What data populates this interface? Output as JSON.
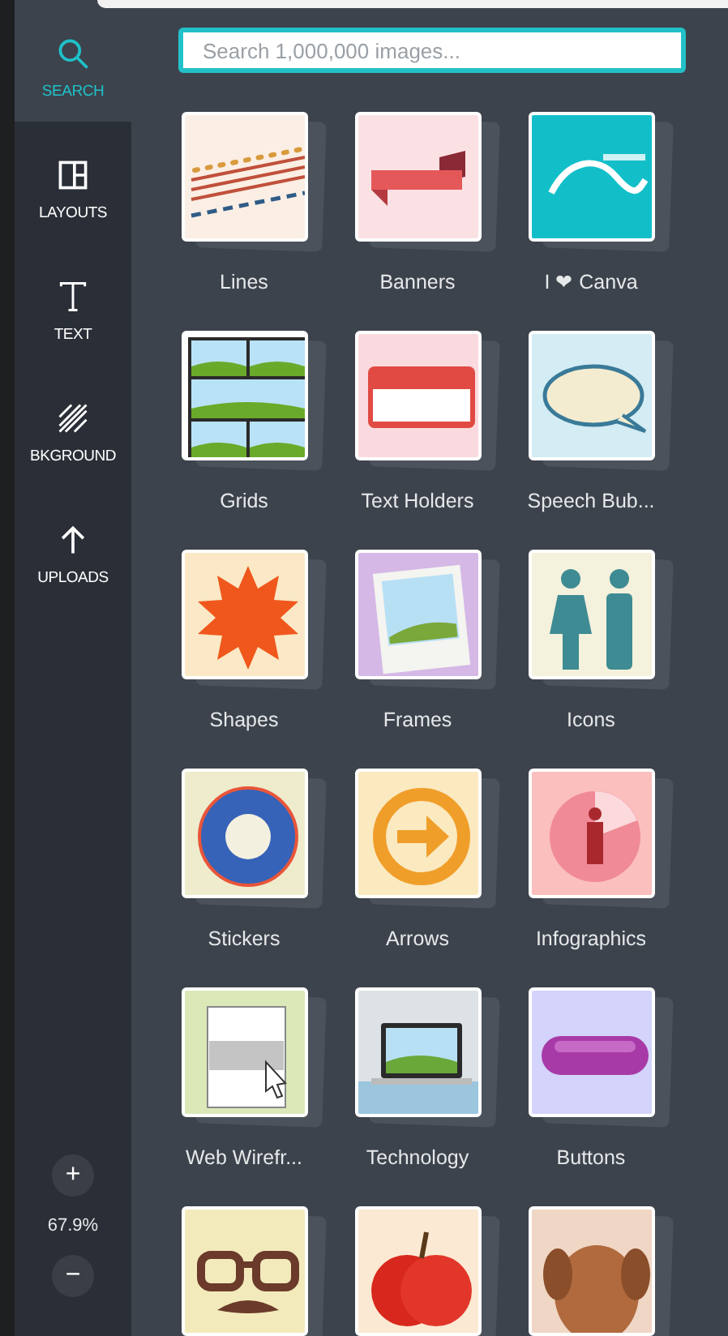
{
  "nav": [
    {
      "label": "SEARCH",
      "kind": "search",
      "selected": true
    },
    {
      "label": "LAYOUTS",
      "kind": "layouts",
      "selected": false
    },
    {
      "label": "TEXT",
      "kind": "text",
      "selected": false
    },
    {
      "label": "BKGROUND",
      "kind": "background",
      "selected": false
    },
    {
      "label": "UPLOADS",
      "kind": "uploads",
      "selected": false
    }
  ],
  "zoom": {
    "plus": "+",
    "value": "67.9%",
    "minus": "−"
  },
  "search": {
    "placeholder": "Search 1,000,000 images..."
  },
  "tiles": [
    {
      "label": "Lines",
      "kind": "lines"
    },
    {
      "label": "Banners",
      "kind": "banner"
    },
    {
      "label": "I ❤ Canva",
      "kind": "badge"
    },
    {
      "label": "Grids",
      "kind": "grid"
    },
    {
      "label": "Text Holders",
      "kind": "nametag"
    },
    {
      "label": "Speech Bub...",
      "kind": "speech"
    },
    {
      "label": "Shapes",
      "kind": "star"
    },
    {
      "label": "Frames",
      "kind": "frame"
    },
    {
      "label": "Icons",
      "kind": "people"
    },
    {
      "label": "Stickers",
      "kind": "sticker"
    },
    {
      "label": "Arrows",
      "kind": "arrow"
    },
    {
      "label": "Infographics",
      "kind": "infographic"
    },
    {
      "label": "Web Wirefr...",
      "kind": "wireframe"
    },
    {
      "label": "Technology",
      "kind": "laptop"
    },
    {
      "label": "Buttons",
      "kind": "pill"
    },
    {
      "kind": "glasses"
    },
    {
      "kind": "apple"
    },
    {
      "kind": "dog"
    }
  ]
}
